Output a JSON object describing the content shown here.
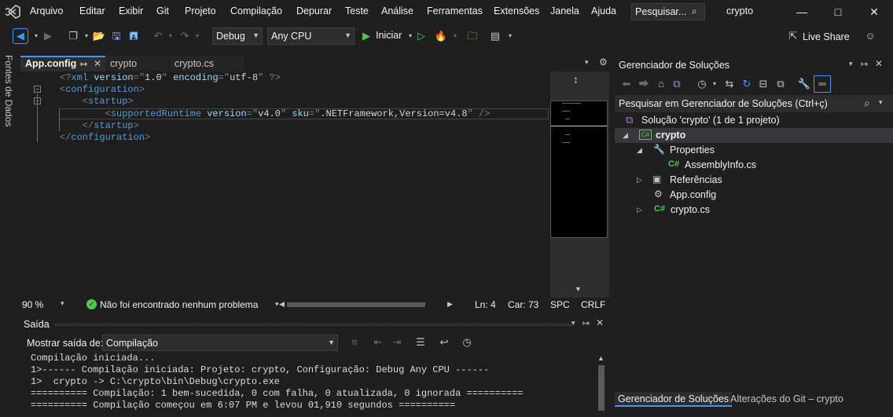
{
  "menubar": {
    "items": [
      "Arquivo",
      "Editar",
      "Exibir",
      "Git",
      "Projeto",
      "Compilação",
      "Depurar",
      "Teste",
      "Análise",
      "Ferramentas",
      "Extensões",
      "Janela",
      "Ajuda"
    ],
    "search_label": "Pesquisar...",
    "title": "crypto"
  },
  "toolbar": {
    "config": "Debug",
    "platform": "Any CPU",
    "start_label": "Iniciar",
    "live_share": "Live Share"
  },
  "left_rail": {
    "label": "Fontes de Dados"
  },
  "editor": {
    "tabs": [
      "App.config",
      "crypto",
      "crypto.cs"
    ],
    "lines": [
      {
        "parts": [
          [
            "c-punc",
            "<?"
          ],
          [
            "c-blue",
            "xml "
          ],
          [
            "c-attr",
            "version"
          ],
          [
            "c-punc",
            "=\""
          ],
          [
            "c-text",
            "1.0"
          ],
          [
            "c-punc",
            "\" "
          ],
          [
            "c-attr",
            "encoding"
          ],
          [
            "c-punc",
            "=\""
          ],
          [
            "c-text",
            "utf-8"
          ],
          [
            "c-punc",
            "\" ?>"
          ]
        ]
      },
      {
        "parts": [
          [
            "c-punc",
            "<"
          ],
          [
            "c-blue",
            "configuration"
          ],
          [
            "c-punc",
            ">"
          ]
        ]
      },
      {
        "parts": [
          [
            "c-punc",
            "    <"
          ],
          [
            "c-blue",
            "startup"
          ],
          [
            "c-punc",
            ">"
          ]
        ]
      },
      {
        "parts": [
          [
            "c-punc",
            "        <"
          ],
          [
            "c-blue",
            "supportedRuntime "
          ],
          [
            "c-attr",
            "version"
          ],
          [
            "c-punc",
            "=\""
          ],
          [
            "c-text",
            "v4.0"
          ],
          [
            "c-punc",
            "\" "
          ],
          [
            "c-attr",
            "sku"
          ],
          [
            "c-punc",
            "=\""
          ],
          [
            "c-text",
            ".NETFramework,Version=v4.8"
          ],
          [
            "c-punc",
            "\" />"
          ]
        ]
      },
      {
        "parts": [
          [
            "c-punc",
            "    </"
          ],
          [
            "c-blue",
            "startup"
          ],
          [
            "c-punc",
            ">"
          ]
        ]
      },
      {
        "parts": [
          [
            "c-punc",
            "</"
          ],
          [
            "c-blue",
            "configuration"
          ],
          [
            "c-punc",
            ">"
          ]
        ]
      }
    ],
    "status": {
      "zoom": "90 %",
      "issues": "Não foi encontrado nenhum problema",
      "line": "Ln: 4",
      "col": "Car: 73",
      "whitespace": "SPC",
      "eol": "CRLF"
    }
  },
  "output": {
    "title": "Saída",
    "show_from_label": "Mostrar saída de:",
    "show_from_value": "Compilação",
    "lines": [
      "Compilação iniciada...",
      "1>------ Compilação iniciada: Projeto: crypto, Configuração: Debug Any CPU ------",
      "1>  crypto -> C:\\crypto\\bin\\Debug\\crypto.exe",
      "========== Compilação: 1 bem-sucedida, 0 com falha, 0 atualizada, 0 ignorada ==========",
      "========== Compilação começou em 6:07 PM e levou 01,910 segundos =========="
    ]
  },
  "solution_explorer": {
    "title": "Gerenciador de Soluções",
    "search_placeholder": "Pesquisar em Gerenciador de Soluções (Ctrl+ç)",
    "tree": {
      "solution": "Solução 'crypto' (1 de 1 projeto)",
      "project": "crypto",
      "properties": "Properties",
      "assembly_info": "AssemblyInfo.cs",
      "references": "Referências",
      "app_config": "App.config",
      "crypto_cs": "crypto.cs"
    },
    "bottom_tabs": [
      "Gerenciador de Soluções",
      "Alterações do Git – crypto"
    ]
  }
}
